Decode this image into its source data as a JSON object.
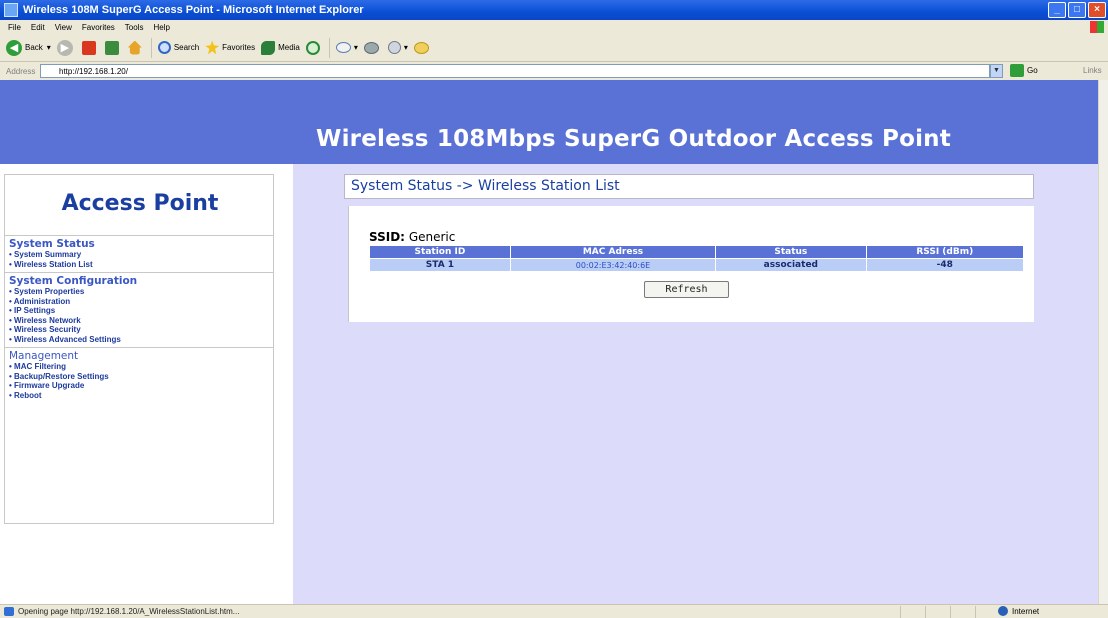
{
  "window": {
    "title": "Wireless 108M SuperG Access Point - Microsoft Internet Explorer"
  },
  "menu": [
    "File",
    "Edit",
    "View",
    "Favorites",
    "Tools",
    "Help"
  ],
  "toolbar": {
    "back": "Back",
    "search": "Search",
    "favorites": "Favorites",
    "media": "Media"
  },
  "address": {
    "label": "Address",
    "url": "http://192.168.1.20/",
    "go": "Go",
    "links": "Links"
  },
  "banner": {
    "title": "Wireless 108Mbps SuperG Outdoor Access Point"
  },
  "sidebar": {
    "brand": "Access Point",
    "sections": [
      {
        "heading": "System Status",
        "items": [
          "System Summary",
          "Wireless Station List"
        ]
      },
      {
        "heading": "System Configuration",
        "items": [
          "System Properties",
          "Administration",
          "IP Settings",
          "Wireless Network",
          "Wireless Security",
          "Wireless Advanced Settings"
        ]
      },
      {
        "heading": "Management",
        "items": [
          "MAC Filtering",
          "Backup/Restore Settings",
          "Firmware Upgrade",
          "Reboot"
        ]
      }
    ]
  },
  "main": {
    "page_heading": "System Status -> Wireless Station List",
    "ssid_label": "SSID:",
    "ssid_value": "Generic",
    "table": {
      "headers": [
        "Station ID",
        "MAC Adress",
        "Status",
        "RSSI (dBm)"
      ],
      "rows": [
        [
          "STA 1",
          "00:02:E3:42:40:6E",
          "associated",
          "-48"
        ]
      ]
    },
    "refresh_label": "Refresh"
  },
  "status": {
    "text": "Opening page http://192.168.1.20/A_WirelessStationList.htm...",
    "zone": "Internet"
  },
  "colors": {
    "banner": "#5a72d6",
    "page_bg": "#dcdcfa",
    "table_header": "#5a72d6",
    "table_row": "#b9cdf7",
    "brand_text": "#1a3fa0"
  }
}
